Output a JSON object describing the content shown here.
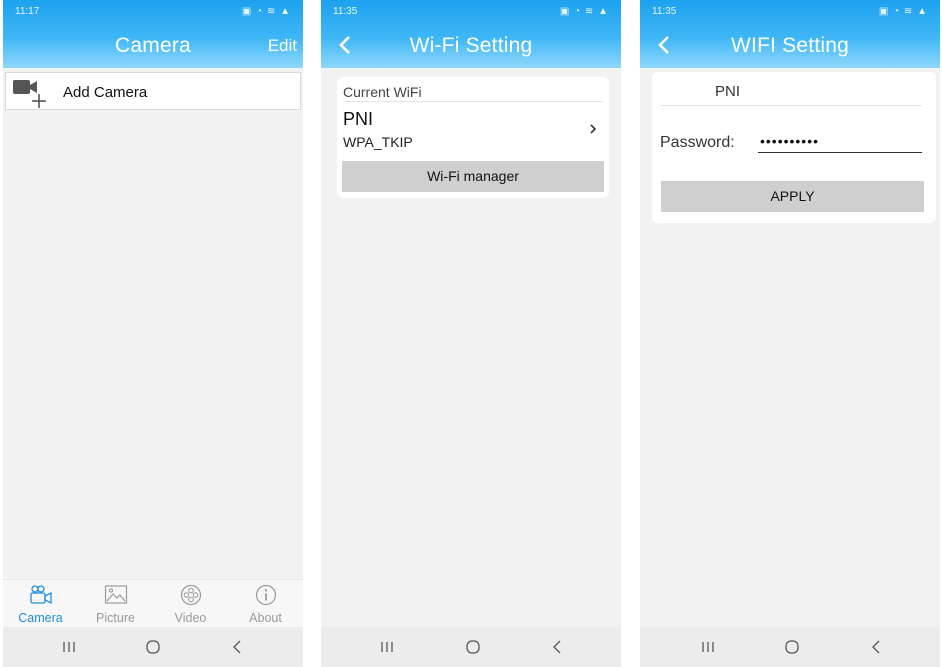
{
  "screens": [
    {
      "status": {
        "time": "11:17",
        "icons": "▣ ◔ ≋ ▲"
      },
      "title": "Camera",
      "edit_label": "Edit",
      "add_camera_label": "Add Camera",
      "tabs": [
        {
          "label": "Camera",
          "icon": "camera-icon",
          "active": true
        },
        {
          "label": "Picture",
          "icon": "picture-icon",
          "active": false
        },
        {
          "label": "Video",
          "icon": "video-icon",
          "active": false
        },
        {
          "label": "About",
          "icon": "info-icon",
          "active": false
        }
      ]
    },
    {
      "status": {
        "time": "11:35",
        "icons": "▣ ◔ ≋ ▲"
      },
      "title": "Wi-Fi Setting",
      "section_label": "Current WiFi",
      "ssid": "PNI",
      "security": "WPA_TKIP",
      "manager_button": "Wi-Fi manager"
    },
    {
      "status": {
        "time": "11:35",
        "icons": "▣ ◔ ≋ ▲"
      },
      "title": "WIFI Setting",
      "ssid": "PNI",
      "password_label": "Password:",
      "password_value": "••••••••••",
      "apply_button": "APPLY"
    }
  ],
  "colors": {
    "appbar": "#1da2ef",
    "active_tab": "#1f8fe0",
    "button_bg": "#cfcfcf",
    "background": "#f2f2f2"
  },
  "nav_buttons": [
    "recent-apps-icon",
    "home-icon",
    "back-icon"
  ]
}
